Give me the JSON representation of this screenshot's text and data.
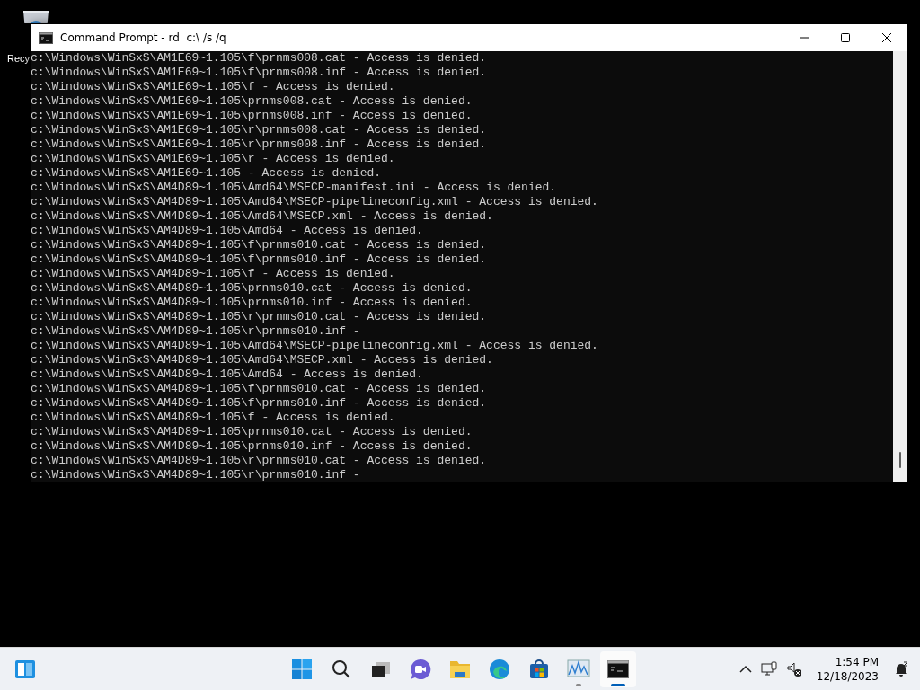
{
  "desktop_icons": [
    {
      "label": "Recy"
    }
  ],
  "window": {
    "title": "Command Prompt - rd  c:\\ /s /q",
    "lines": [
      "c:\\Windows\\WinSxS\\AM1E69~1.105\\f\\prnms008.cat - Access is denied.",
      "c:\\Windows\\WinSxS\\AM1E69~1.105\\f\\prnms008.inf - Access is denied.",
      "c:\\Windows\\WinSxS\\AM1E69~1.105\\f - Access is denied.",
      "c:\\Windows\\WinSxS\\AM1E69~1.105\\prnms008.cat - Access is denied.",
      "c:\\Windows\\WinSxS\\AM1E69~1.105\\prnms008.inf - Access is denied.",
      "c:\\Windows\\WinSxS\\AM1E69~1.105\\r\\prnms008.cat - Access is denied.",
      "c:\\Windows\\WinSxS\\AM1E69~1.105\\r\\prnms008.inf - Access is denied.",
      "c:\\Windows\\WinSxS\\AM1E69~1.105\\r - Access is denied.",
      "c:\\Windows\\WinSxS\\AM1E69~1.105 - Access is denied.",
      "c:\\Windows\\WinSxS\\AM4D89~1.105\\Amd64\\MSECP-manifest.ini - Access is denied.",
      "c:\\Windows\\WinSxS\\AM4D89~1.105\\Amd64\\MSECP-pipelineconfig.xml - Access is denied.",
      "c:\\Windows\\WinSxS\\AM4D89~1.105\\Amd64\\MSECP.xml - Access is denied.",
      "c:\\Windows\\WinSxS\\AM4D89~1.105\\Amd64 - Access is denied.",
      "c:\\Windows\\WinSxS\\AM4D89~1.105\\f\\prnms010.cat - Access is denied.",
      "c:\\Windows\\WinSxS\\AM4D89~1.105\\f\\prnms010.inf - Access is denied.",
      "c:\\Windows\\WinSxS\\AM4D89~1.105\\f - Access is denied.",
      "c:\\Windows\\WinSxS\\AM4D89~1.105\\prnms010.cat - Access is denied.",
      "c:\\Windows\\WinSxS\\AM4D89~1.105\\prnms010.inf - Access is denied.",
      "c:\\Windows\\WinSxS\\AM4D89~1.105\\r\\prnms010.cat - Access is denied.",
      "c:\\Windows\\WinSxS\\AM4D89~1.105\\r\\prnms010.inf -",
      "c:\\Windows\\WinSxS\\AM4D89~1.105\\Amd64\\MSECP-pipelineconfig.xml - Access is denied.",
      "c:\\Windows\\WinSxS\\AM4D89~1.105\\Amd64\\MSECP.xml - Access is denied.",
      "c:\\Windows\\WinSxS\\AM4D89~1.105\\Amd64 - Access is denied.",
      "c:\\Windows\\WinSxS\\AM4D89~1.105\\f\\prnms010.cat - Access is denied.",
      "c:\\Windows\\WinSxS\\AM4D89~1.105\\f\\prnms010.inf - Access is denied.",
      "c:\\Windows\\WinSxS\\AM4D89~1.105\\f - Access is denied.",
      "c:\\Windows\\WinSxS\\AM4D89~1.105\\prnms010.cat - Access is denied.",
      "c:\\Windows\\WinSxS\\AM4D89~1.105\\prnms010.inf - Access is denied.",
      "c:\\Windows\\WinSxS\\AM4D89~1.105\\r\\prnms010.cat - Access is denied.",
      "c:\\Windows\\WinSxS\\AM4D89~1.105\\r\\prnms010.inf -"
    ]
  },
  "taskbar": {
    "apps": [
      {
        "kind": "start",
        "running": false,
        "selected": false
      },
      {
        "kind": "search",
        "running": false,
        "selected": false
      },
      {
        "kind": "taskview",
        "running": false,
        "selected": false
      },
      {
        "kind": "chat",
        "running": false,
        "selected": false
      },
      {
        "kind": "explorer",
        "running": false,
        "selected": false
      },
      {
        "kind": "edge",
        "running": false,
        "selected": false
      },
      {
        "kind": "store",
        "running": false,
        "selected": false
      },
      {
        "kind": "perfmon",
        "running": true,
        "selected": false
      },
      {
        "kind": "cmd",
        "running": true,
        "selected": true
      }
    ],
    "time": "1:54 PM",
    "date": "12/18/2023"
  }
}
